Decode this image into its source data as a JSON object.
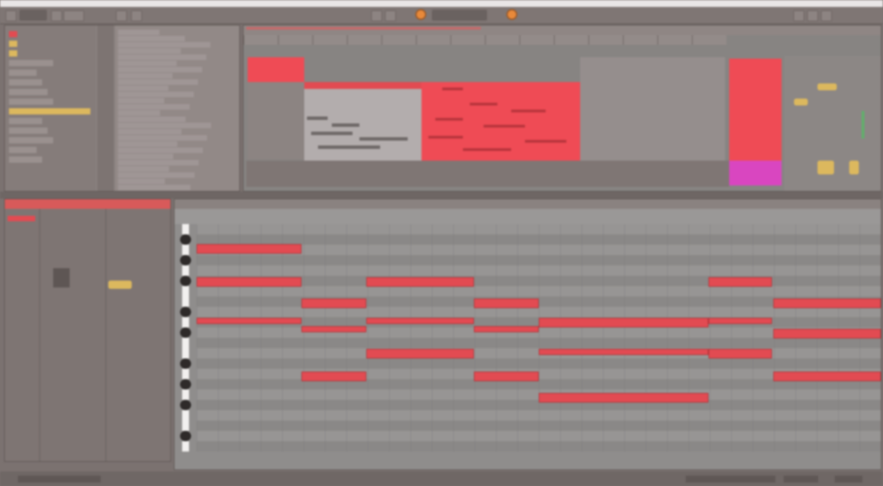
{
  "transport": {
    "tempo": "",
    "position": ""
  },
  "browser": {
    "places": [
      "",
      "",
      "",
      "",
      "",
      "",
      "",
      "",
      "",
      "",
      "",
      "",
      "",
      ""
    ],
    "selected_index": 8
  },
  "device": {
    "title": ""
  },
  "colors": {
    "accent": "#e24b52",
    "clip_pink": "#d946c0",
    "knob": "#dcb85e",
    "orb": "#e8893a"
  }
}
